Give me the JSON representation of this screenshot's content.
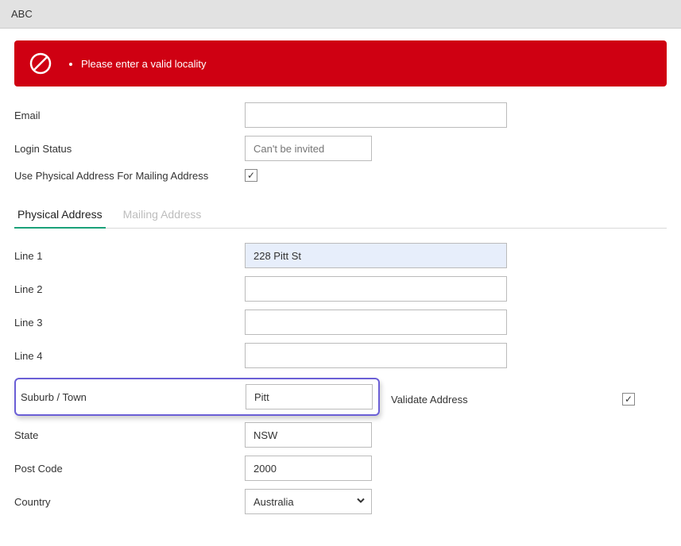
{
  "header": {
    "title": "ABC"
  },
  "error": {
    "message": "Please enter a valid locality"
  },
  "form": {
    "email_label": "Email",
    "email_value": "",
    "login_status_label": "Login Status",
    "login_status_placeholder": "Can't be invited",
    "use_physical_label": "Use Physical Address For Mailing Address",
    "use_physical_checked": "✓"
  },
  "tabs": {
    "physical": "Physical Address",
    "mailing": "Mailing Address"
  },
  "address": {
    "line1_label": "Line 1",
    "line1_value": "228 Pitt St",
    "line2_label": "Line 2",
    "line2_value": "",
    "line3_label": "Line 3",
    "line3_value": "",
    "line4_label": "Line 4",
    "line4_value": "",
    "suburb_label": "Suburb / Town",
    "suburb_value": "Pitt",
    "validate_label": "Validate Address",
    "validate_checked": "✓",
    "state_label": "State",
    "state_value": "NSW",
    "postcode_label": "Post Code",
    "postcode_value": "2000",
    "country_label": "Country",
    "country_value": "Australia"
  }
}
